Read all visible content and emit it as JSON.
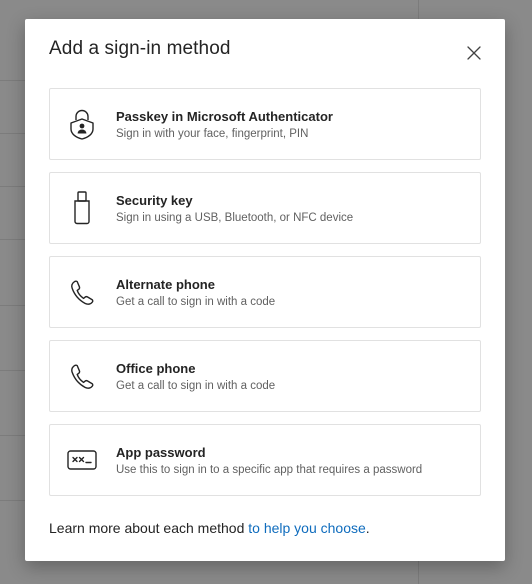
{
  "dialog": {
    "title": "Add a sign-in method",
    "close_icon": "close-icon"
  },
  "methods": [
    {
      "icon": "passkey-icon",
      "title": "Passkey in Microsoft Authenticator",
      "description": "Sign in with your face, fingerprint, PIN"
    },
    {
      "icon": "security-key-icon",
      "title": "Security key",
      "description": "Sign in using a USB, Bluetooth, or NFC device"
    },
    {
      "icon": "phone-icon",
      "title": "Alternate phone",
      "description": "Get a call to sign in with a code"
    },
    {
      "icon": "phone-icon",
      "title": "Office phone",
      "description": "Get a call to sign in with a code"
    },
    {
      "icon": "app-password-icon",
      "title": "App password",
      "description": "Use this to sign in to a specific app that requires a password"
    }
  ],
  "footer": {
    "text": "Learn more about each method ",
    "link_text": "to help you choose",
    "trailing": "."
  },
  "colors": {
    "link": "#0f6cbd",
    "text": "#242424",
    "secondary_text": "#616161",
    "card_border": "#e1e1e1",
    "overlay": "#8a8a8a"
  }
}
